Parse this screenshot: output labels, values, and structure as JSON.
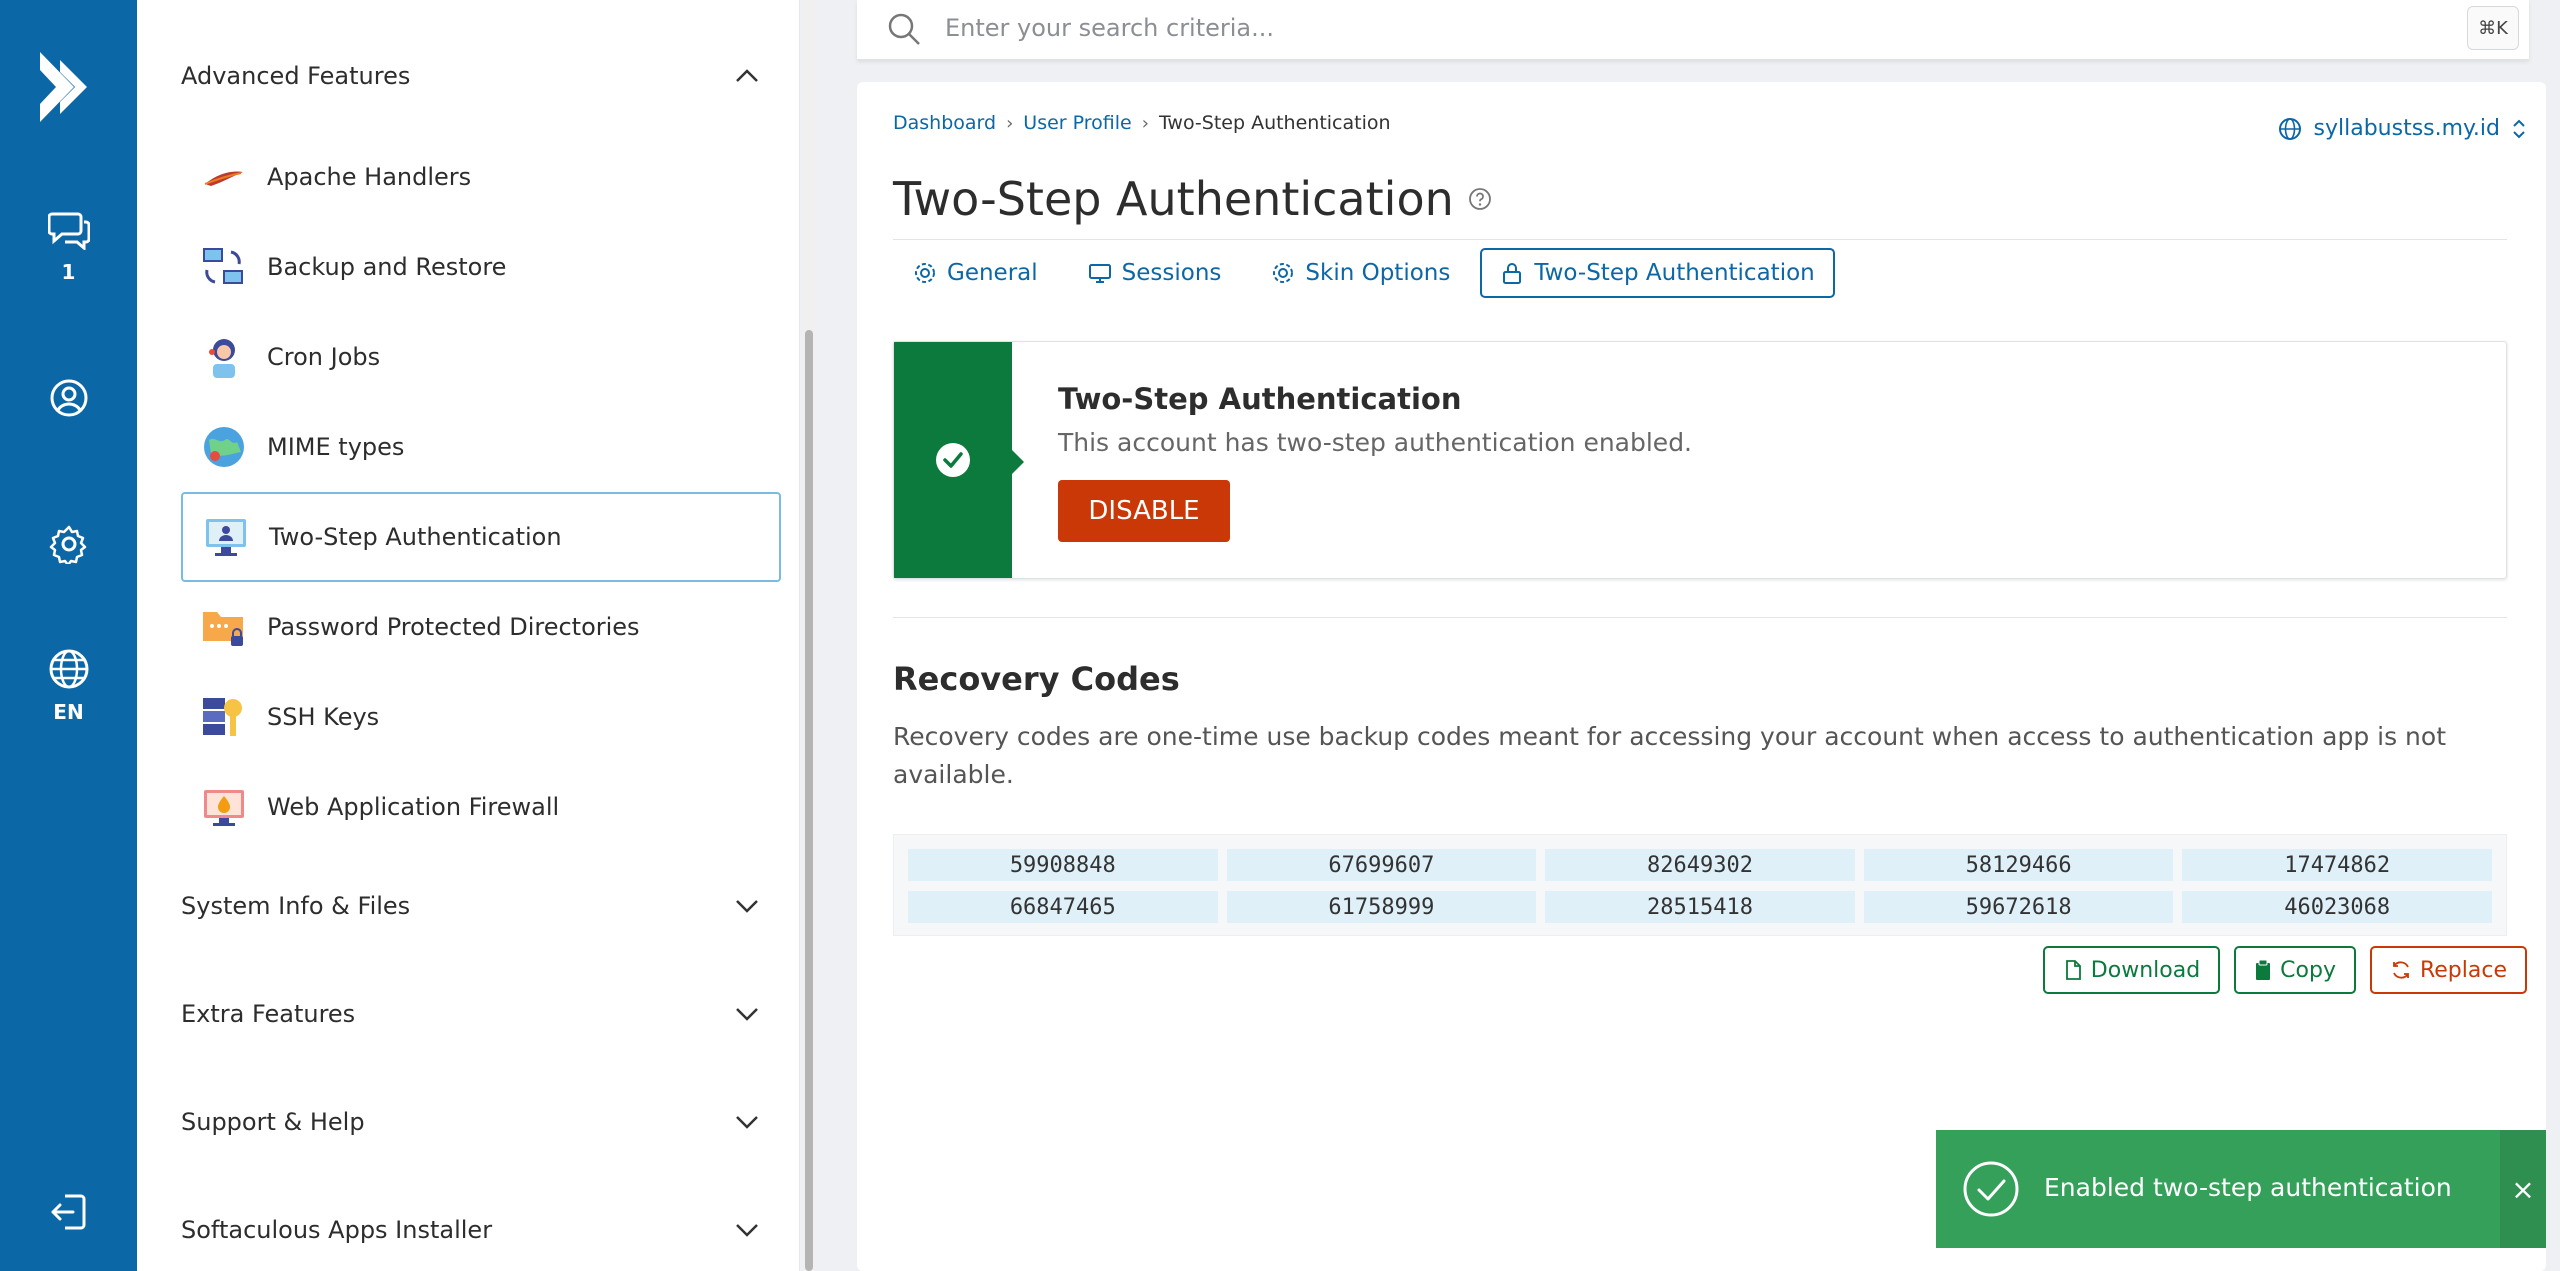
{
  "rail": {
    "items": [
      {
        "name": "messages",
        "badge": "1"
      },
      {
        "name": "profile"
      },
      {
        "name": "settings"
      },
      {
        "name": "language",
        "label": "EN"
      },
      {
        "name": "logout"
      }
    ]
  },
  "sidebar": {
    "sections": [
      {
        "label": "Advanced Features",
        "expanded": true
      },
      {
        "label": "System Info & Files",
        "expanded": false
      },
      {
        "label": "Extra Features",
        "expanded": false
      },
      {
        "label": "Support & Help",
        "expanded": false
      },
      {
        "label": "Softaculous Apps Installer",
        "expanded": false
      }
    ],
    "items": [
      {
        "label": "Apache Handlers"
      },
      {
        "label": "Backup and Restore"
      },
      {
        "label": "Cron Jobs"
      },
      {
        "label": "MIME types"
      },
      {
        "label": "Two-Step Authentication",
        "active": true
      },
      {
        "label": "Password Protected Directories"
      },
      {
        "label": "SSH Keys"
      },
      {
        "label": "Web Application Firewall"
      }
    ]
  },
  "search": {
    "placeholder": "Enter your search criteria...",
    "shortcut": "⌘K"
  },
  "breadcrumb": [
    "Dashboard",
    "User Profile",
    "Two-Step Authentication"
  ],
  "domain": "syllabustss.my.id",
  "page_title": "Two-Step Authentication",
  "tabs": [
    {
      "label": "General"
    },
    {
      "label": "Sessions"
    },
    {
      "label": "Skin Options"
    },
    {
      "label": "Two-Step Authentication",
      "active": true
    }
  ],
  "status": {
    "title": "Two-Step Authentication",
    "description": "This account has two-step authentication enabled.",
    "button": "DISABLE"
  },
  "recovery": {
    "title": "Recovery Codes",
    "description": "Recovery codes are one-time use backup codes meant for accessing your account when access to authentication app is not available.",
    "codes": [
      "59908848",
      "67699607",
      "82649302",
      "58129466",
      "17474862",
      "66847465",
      "61758999",
      "28515418",
      "59672618",
      "46023068"
    ],
    "actions": {
      "download": "Download",
      "copy": "Copy",
      "replace": "Replace"
    }
  },
  "toast": {
    "message": "Enabled two-step authentication",
    "close": "×"
  },
  "colors": {
    "brand": "#0c67a7",
    "success": "#0b7a3c",
    "danger": "#c93806",
    "toast": "#34a05a"
  }
}
